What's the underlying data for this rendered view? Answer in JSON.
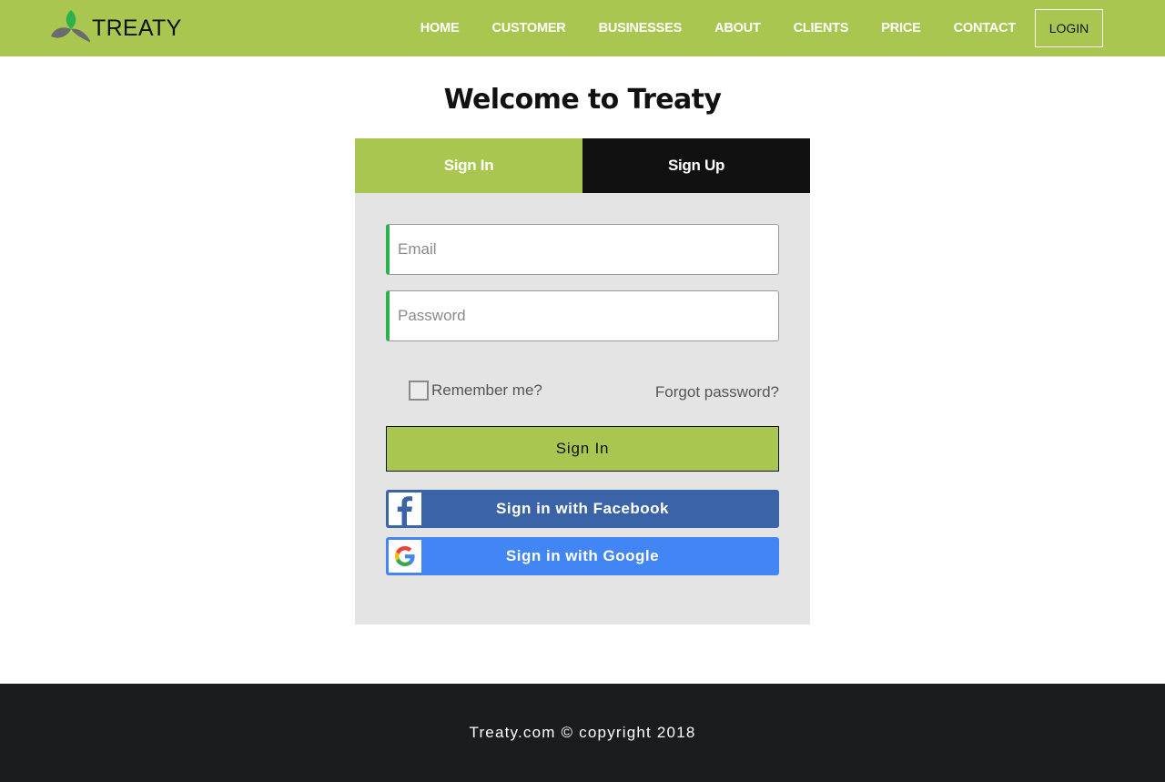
{
  "brand": {
    "name": "TREATY",
    "color": "#a9c650"
  },
  "nav": {
    "items": [
      "HOME",
      "CUSTOMER",
      "BUSINESSES",
      "ABOUT",
      "CLIENTS",
      "PRICE",
      "CONTACT"
    ],
    "login_label": "LOGIN"
  },
  "page": {
    "welcome": "Welcome to Treaty"
  },
  "tabs": {
    "signin_label": "Sign In",
    "signup_label": "Sign Up",
    "active": "Sign In"
  },
  "form": {
    "email_placeholder": "Email",
    "email_value": "",
    "password_placeholder": "Password",
    "password_value": "",
    "remember_label": "Remember me?",
    "remember_checked": false,
    "forgot_label": "Forgot password?",
    "submit_label": "Sign In"
  },
  "social": {
    "facebook_label": "Sign in with Facebook",
    "facebook_icon": "facebook-icon",
    "facebook_color": "#3b64a8",
    "google_label": "Sign in with Google",
    "google_icon": "google-icon",
    "google_color": "#4286f5"
  },
  "footer": {
    "text": "Treaty.com © copyright 2018"
  }
}
